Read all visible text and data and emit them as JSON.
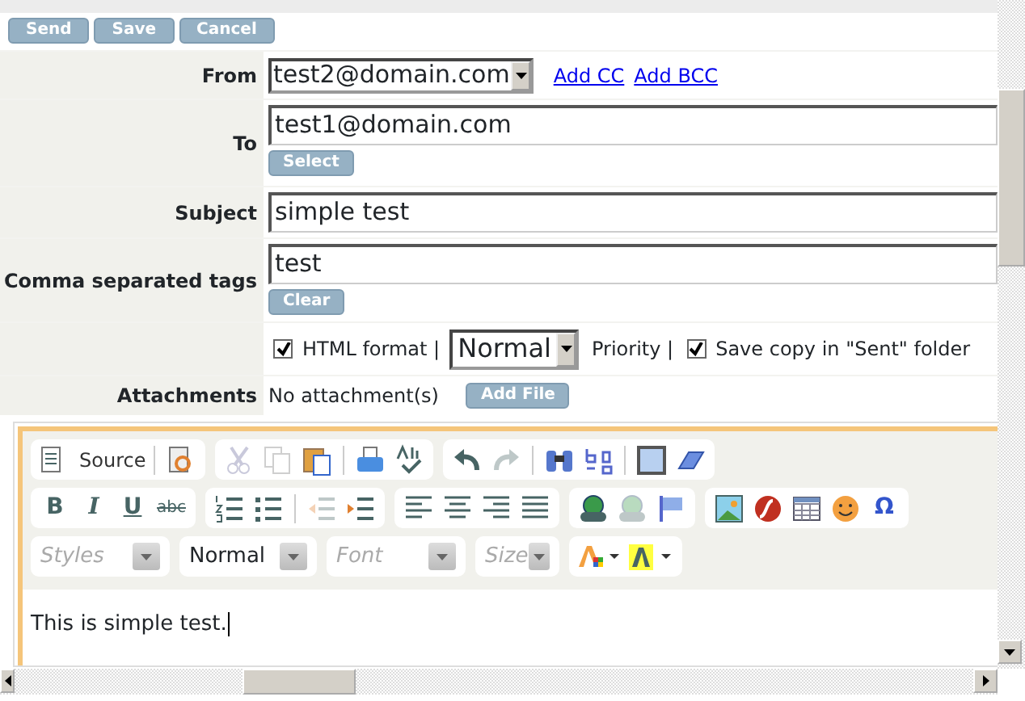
{
  "actions": [
    {
      "label": "Send"
    },
    {
      "label": "Save"
    },
    {
      "label": "Cancel"
    }
  ],
  "from": {
    "label": "From",
    "value": "test2@domain.com",
    "links": [
      "Add CC",
      "Add BCC"
    ]
  },
  "to": {
    "label": "To",
    "value": "test1@domain.com",
    "button": "Select"
  },
  "subject": {
    "label": "Subject",
    "value": "simple test"
  },
  "tags": {
    "label": "Comma separated tags",
    "value": "test",
    "button": "Clear"
  },
  "options": {
    "html_format": {
      "label": "HTML format |",
      "checked": true
    },
    "priority": {
      "value": "Normal",
      "label": "Priority |"
    },
    "save_copy": {
      "label": "Save copy in \"Sent\" folder",
      "checked": true
    }
  },
  "attachments": {
    "label": "Attachments",
    "value": "No attachment(s)",
    "button": "Add File"
  },
  "editor": {
    "toolbar_rows": [
      [
        [
          {
            "kind": "source",
            "label": "Source",
            "disabled": false
          },
          {
            "kind": "sep"
          },
          {
            "kind": "preview",
            "disabled": false
          }
        ],
        [
          {
            "kind": "cut",
            "disabled": true
          },
          {
            "kind": "copy",
            "disabled": true
          },
          {
            "kind": "paste",
            "disabled": false
          },
          {
            "kind": "sep"
          },
          {
            "kind": "print",
            "disabled": false
          },
          {
            "kind": "spellcheck",
            "disabled": false
          }
        ],
        [
          {
            "kind": "undo",
            "disabled": false
          },
          {
            "kind": "redo",
            "disabled": true
          },
          {
            "kind": "sep"
          },
          {
            "kind": "find",
            "disabled": false
          },
          {
            "kind": "replace",
            "disabled": false
          },
          {
            "kind": "sep"
          },
          {
            "kind": "selectall",
            "disabled": false
          },
          {
            "kind": "eraser",
            "disabled": false
          }
        ]
      ],
      [
        [
          {
            "kind": "bold",
            "glyph": "B",
            "disabled": false
          },
          {
            "kind": "italic",
            "glyph": "I",
            "disabled": false
          },
          {
            "kind": "underline",
            "glyph": "U",
            "disabled": false
          },
          {
            "kind": "strike",
            "glyph": "abc",
            "disabled": false
          }
        ],
        [
          {
            "kind": "ol",
            "disabled": false
          },
          {
            "kind": "ul",
            "disabled": false
          },
          {
            "kind": "sep"
          },
          {
            "kind": "outdent",
            "disabled": true
          },
          {
            "kind": "indent",
            "disabled": false
          }
        ],
        [
          {
            "kind": "alignleft",
            "disabled": false
          },
          {
            "kind": "aligncenter",
            "disabled": false
          },
          {
            "kind": "alignright",
            "disabled": false
          },
          {
            "kind": "justify",
            "disabled": false
          }
        ],
        [
          {
            "kind": "link",
            "disabled": false
          },
          {
            "kind": "unlink",
            "disabled": true
          },
          {
            "kind": "anchor",
            "disabled": false
          }
        ],
        [
          {
            "kind": "image",
            "disabled": false
          },
          {
            "kind": "flash",
            "disabled": false
          },
          {
            "kind": "table",
            "disabled": false
          },
          {
            "kind": "smiley",
            "disabled": false
          },
          {
            "kind": "omega",
            "glyph": "Ω",
            "disabled": false
          }
        ]
      ]
    ],
    "combos": [
      {
        "placeholder": "Styles"
      },
      {
        "value": "Normal"
      },
      {
        "placeholder": "Font"
      },
      {
        "placeholder": "Size"
      }
    ],
    "color_buttons": [
      {
        "kind": "textcolor"
      },
      {
        "kind": "bgcolor"
      }
    ],
    "body": "This is simple test."
  }
}
